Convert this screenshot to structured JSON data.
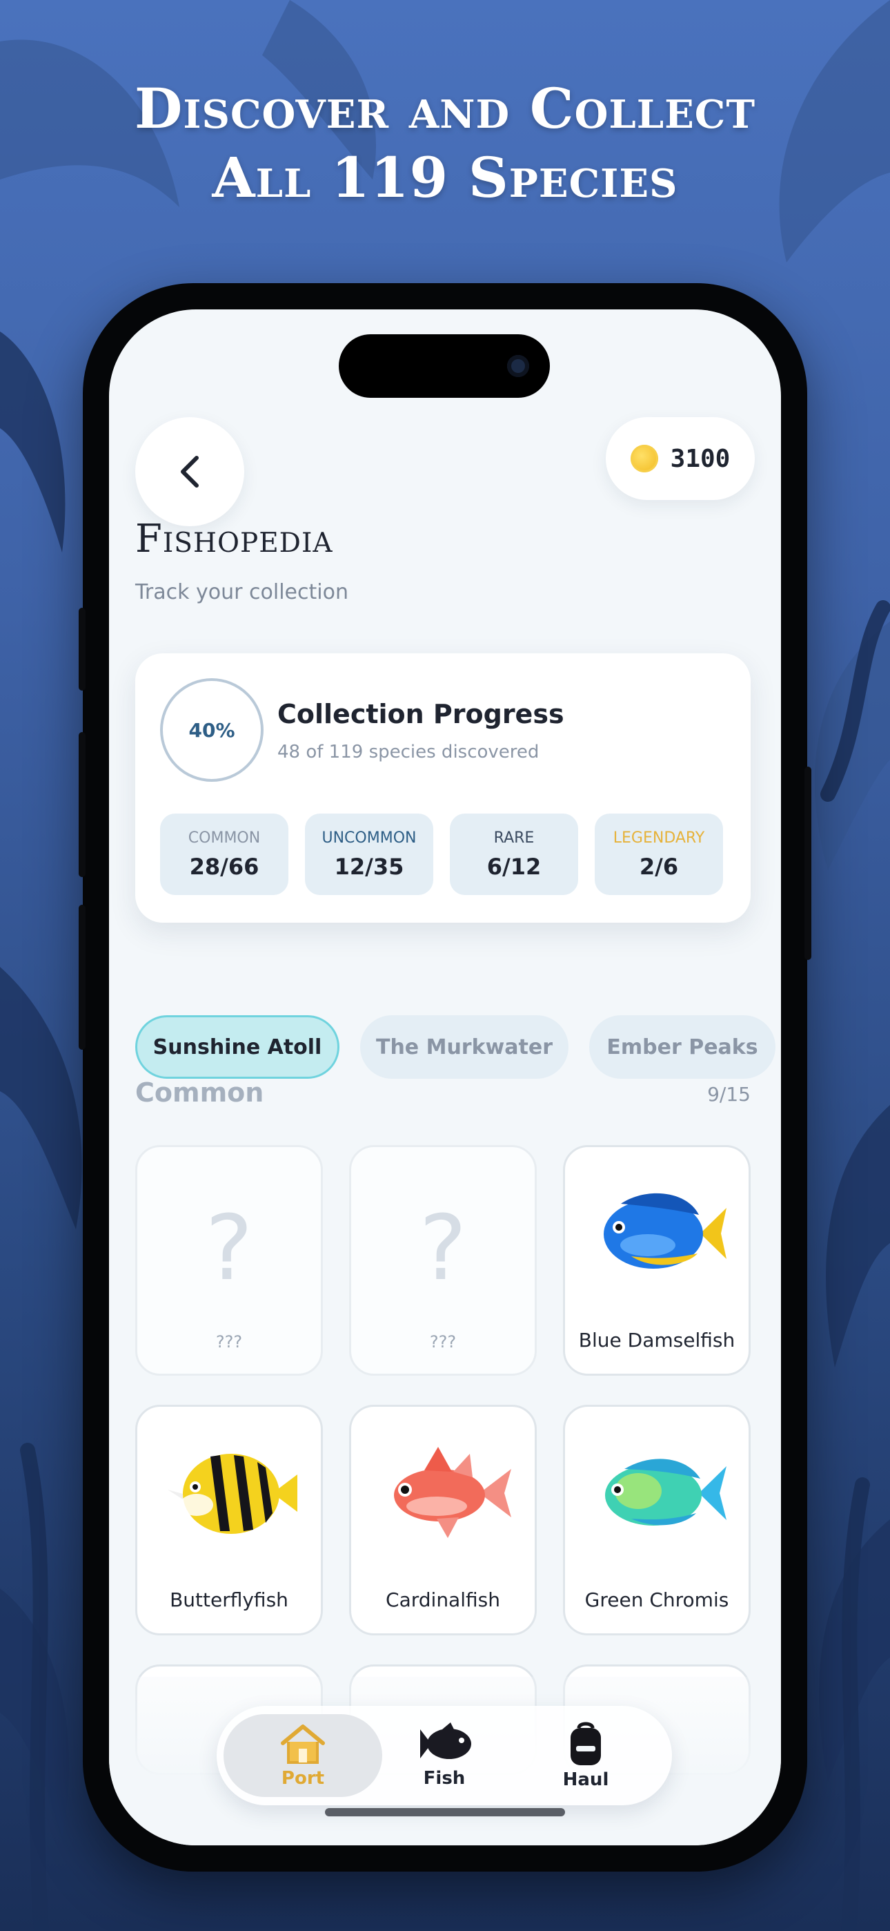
{
  "headline": {
    "line1": "Discover and Collect",
    "line2": "All 119 Species"
  },
  "header": {
    "back_icon": "chevron-left-icon",
    "coin_icon": "coin-icon",
    "coins": "3100"
  },
  "page": {
    "title": "Fishopedia",
    "subtitle": "Track your collection"
  },
  "progress": {
    "percent_label": "40%",
    "percent_value": 40,
    "title": "Collection Progress",
    "subtitle": "48 of 119 species discovered",
    "rarities": [
      {
        "label": "COMMON",
        "value": "28/66",
        "color": "#8a95a5"
      },
      {
        "label": "UNCOMMON",
        "value": "12/35",
        "color": "#2e5e86"
      },
      {
        "label": "RARE",
        "value": "6/12",
        "color": "#3a4a60"
      },
      {
        "label": "LEGENDARY",
        "value": "2/6",
        "color": "#e6b23a"
      }
    ]
  },
  "regions": [
    {
      "label": "Sunshine Atoll",
      "active": true
    },
    {
      "label": "The Murkwater",
      "active": false
    },
    {
      "label": "Ember Peaks",
      "active": false
    }
  ],
  "section": {
    "title": "Common",
    "count": "9/15"
  },
  "fish_cards": [
    {
      "name": "???",
      "locked": true
    },
    {
      "name": "???",
      "locked": true
    },
    {
      "name": "Blue Damselfish",
      "locked": false,
      "icon": "blue-damselfish-icon"
    },
    {
      "name": "Butterflyfish",
      "locked": false,
      "icon": "butterflyfish-icon"
    },
    {
      "name": "Cardinalfish",
      "locked": false,
      "icon": "cardinalfish-icon"
    },
    {
      "name": "Green Chromis",
      "locked": false,
      "icon": "green-chromis-icon"
    }
  ],
  "bottom_nav": [
    {
      "label": "Port",
      "icon": "house-icon",
      "active": true
    },
    {
      "label": "Fish",
      "icon": "fish-icon",
      "active": false
    },
    {
      "label": "Haul",
      "icon": "backpack-icon",
      "active": false
    }
  ],
  "colors": {
    "accent": "#6fd3de",
    "gold": "#e0a934",
    "background": "#3f63a8"
  }
}
